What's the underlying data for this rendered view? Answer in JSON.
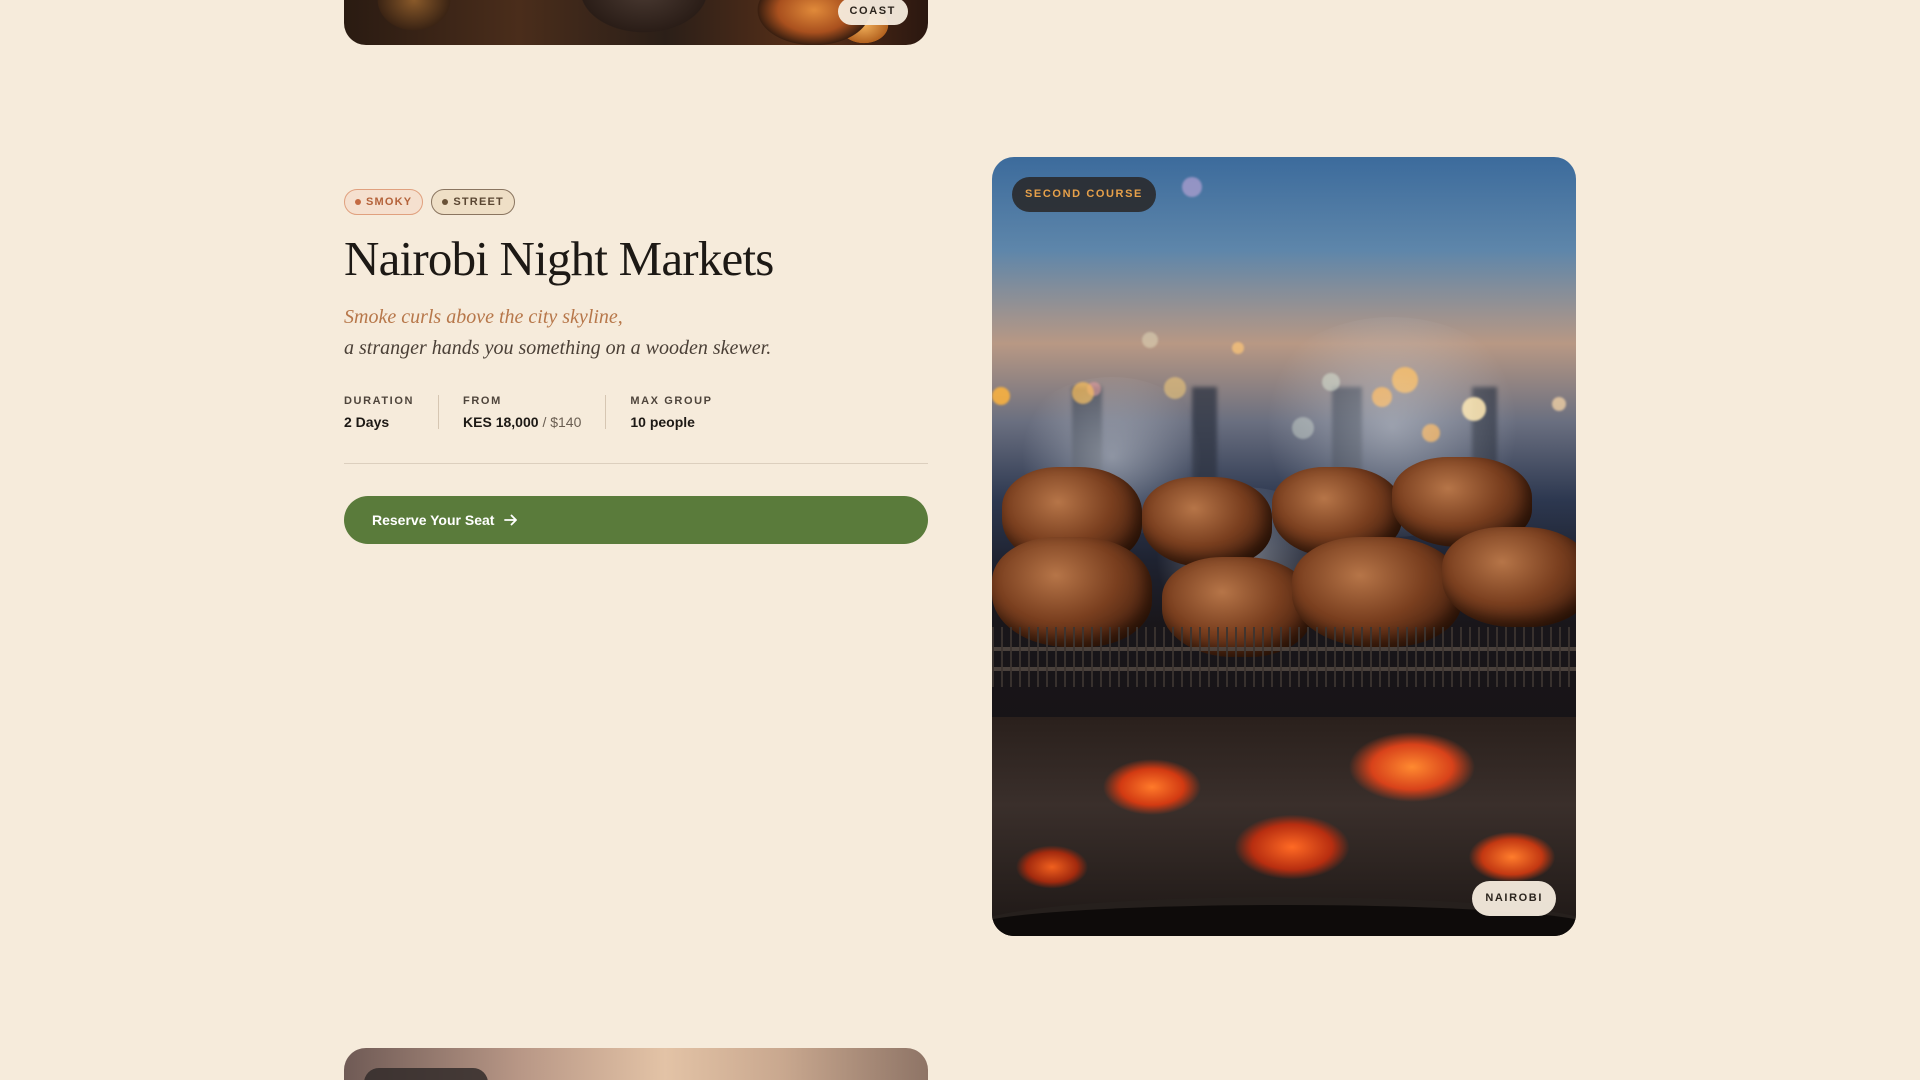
{
  "top_card": {
    "badge": "COAST"
  },
  "tour": {
    "tags": [
      "SMOKY",
      "STREET"
    ],
    "title": "Nairobi Night Markets",
    "subtitle_line1": "Smoke curls above the city skyline,",
    "subtitle_line2": "a stranger hands you something on a wooden skewer.",
    "stats": {
      "duration": {
        "label": "DURATION",
        "value": "2 Days"
      },
      "from": {
        "label": "FROM",
        "value": "KES 18,000",
        "alt": "/ $140"
      },
      "max_group": {
        "label": "MAX GROUP",
        "value": "10 people"
      }
    },
    "cta_label": "Reserve Your Seat",
    "cta_icon": "arrow-right-icon",
    "image": {
      "badge_course": "SECOND COURSE",
      "badge_location": "NAIROBI"
    }
  },
  "colors": {
    "background": "#f6ebdb",
    "accent_green": "#5a7b3b",
    "accent_copper": "#b7774a",
    "badge_gold": "#e6a14a"
  }
}
